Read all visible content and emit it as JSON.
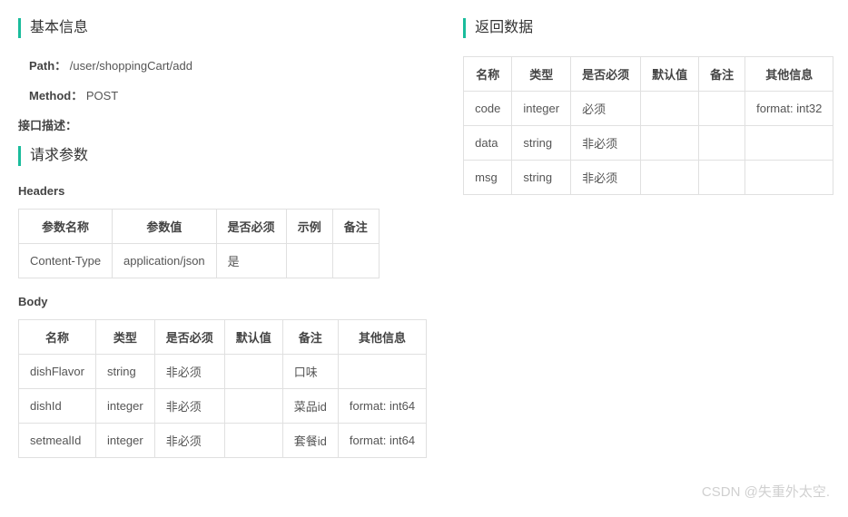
{
  "basic_info": {
    "title": "基本信息",
    "path_label": "Path：",
    "path_value": "/user/shoppingCart/add",
    "method_label": "Method：",
    "method_value": "POST",
    "desc_label": "接口描述："
  },
  "request": {
    "title": "请求参数",
    "headers_title": "Headers",
    "headers_columns": [
      "参数名称",
      "参数值",
      "是否必须",
      "示例",
      "备注"
    ],
    "headers_rows": [
      {
        "name": "Content-Type",
        "value": "application/json",
        "required": "是",
        "example": "",
        "remark": ""
      }
    ],
    "body_title": "Body",
    "body_columns": [
      "名称",
      "类型",
      "是否必须",
      "默认值",
      "备注",
      "其他信息"
    ],
    "body_rows": [
      {
        "name": "dishFlavor",
        "type": "string",
        "required": "非必须",
        "default": "",
        "remark": "口味",
        "other": ""
      },
      {
        "name": "dishId",
        "type": "integer",
        "required": "非必须",
        "default": "",
        "remark": "菜品id",
        "other": "format: int64"
      },
      {
        "name": "setmealId",
        "type": "integer",
        "required": "非必须",
        "default": "",
        "remark": "套餐id",
        "other": "format: int64"
      }
    ]
  },
  "response": {
    "title": "返回数据",
    "columns": [
      "名称",
      "类型",
      "是否必须",
      "默认值",
      "备注",
      "其他信息"
    ],
    "rows": [
      {
        "name": "code",
        "type": "integer",
        "required": "必须",
        "default": "",
        "remark": "",
        "other": "format: int32"
      },
      {
        "name": "data",
        "type": "string",
        "required": "非必须",
        "default": "",
        "remark": "",
        "other": ""
      },
      {
        "name": "msg",
        "type": "string",
        "required": "非必须",
        "default": "",
        "remark": "",
        "other": ""
      }
    ]
  },
  "watermark": "CSDN @失重外太空."
}
